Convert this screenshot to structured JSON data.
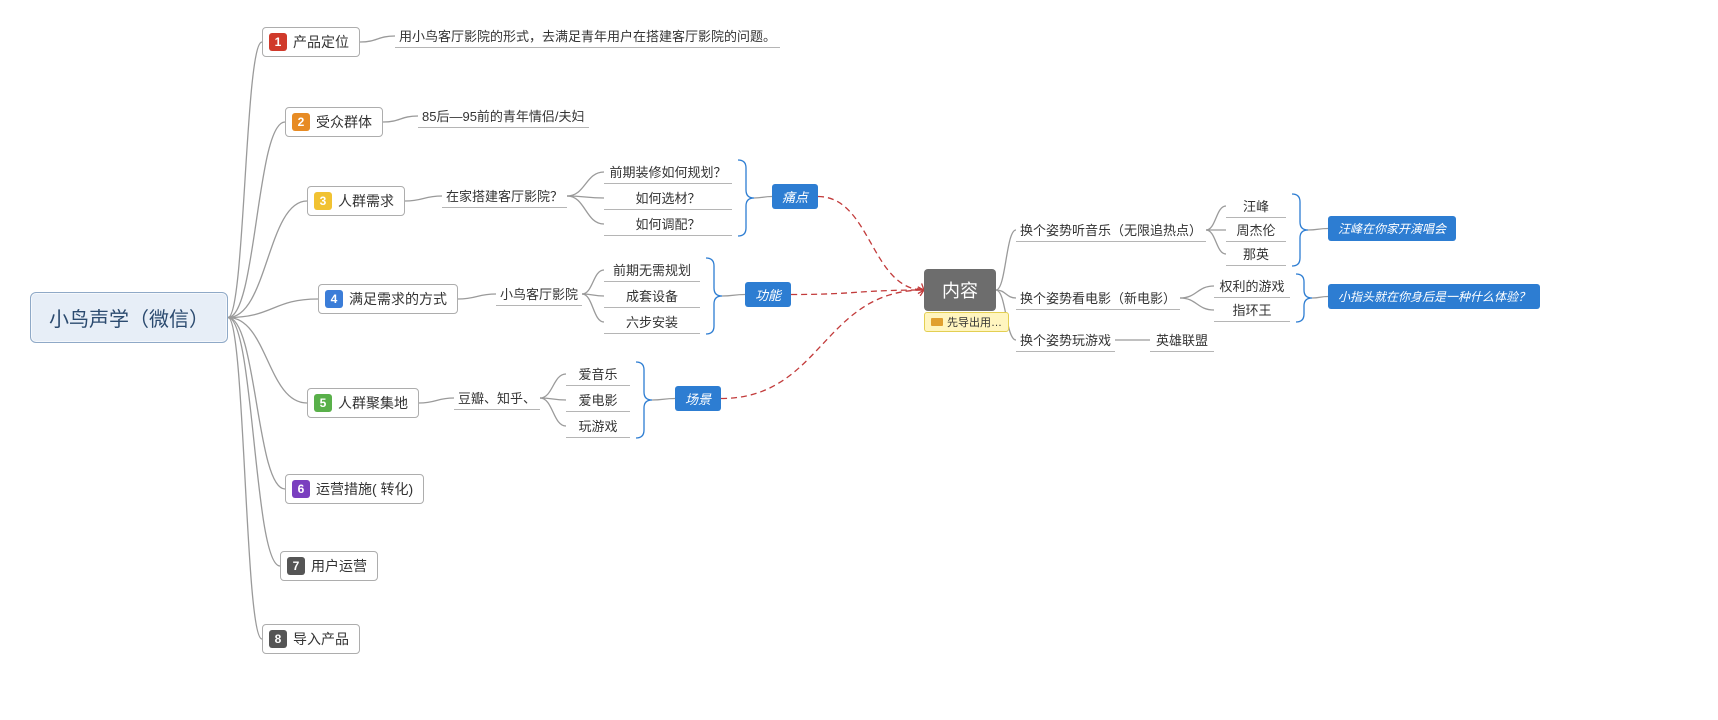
{
  "root": {
    "label": "小鸟声学（微信）"
  },
  "branches": [
    {
      "num": "1",
      "label": "产品定位",
      "color": "#d03a2b",
      "leaf": "用小鸟客厅影院的形式，去满足青年用户在搭建客厅影院的问题。"
    },
    {
      "num": "2",
      "label": "受众群体",
      "color": "#e78b24",
      "leaf": "85后—95前的青年情侣/夫妇"
    },
    {
      "num": "3",
      "label": "人群需求",
      "color": "#f1c232",
      "mid": "在家搭建客厅影院？",
      "subs": [
        "前期装修如何规划？",
        "如何选材？",
        "如何调配？"
      ],
      "tag": "痛点"
    },
    {
      "num": "4",
      "label": "满足需求的方式",
      "color": "#3b7dd8",
      "mid": "小鸟客厅影院",
      "subs": [
        "前期无需规划",
        "成套设备",
        "六步安装"
      ],
      "tag": "功能"
    },
    {
      "num": "5",
      "label": "人群聚集地",
      "color": "#59b04a",
      "mid": "豆瓣、知乎、",
      "subs": [
        "爱音乐",
        "爱电影",
        "玩游戏"
      ],
      "tag": "场景"
    },
    {
      "num": "6",
      "label": "运营措施( 转化)",
      "color": "#7a3fbf"
    },
    {
      "num": "7",
      "label": "用户运营",
      "color": "#555555"
    },
    {
      "num": "8",
      "label": "导入产品",
      "color": "#555555"
    }
  ],
  "content": {
    "title": "内容",
    "annotation": "先导出用…",
    "rows": [
      {
        "a": "换个姿势听音乐（无限追热点）",
        "subs": [
          "汪峰",
          "周杰伦",
          "那英"
        ],
        "note": "汪峰在你家开演唱会"
      },
      {
        "a": "换个姿势看电影（新电影）",
        "subs": [
          "权利的游戏",
          "指环王"
        ],
        "note": "小指头就在你身后是一种什么体验？"
      },
      {
        "a": "换个姿势玩游戏",
        "b": "英雄联盟"
      }
    ]
  },
  "colors": {
    "accent": "#2d7dd2"
  }
}
